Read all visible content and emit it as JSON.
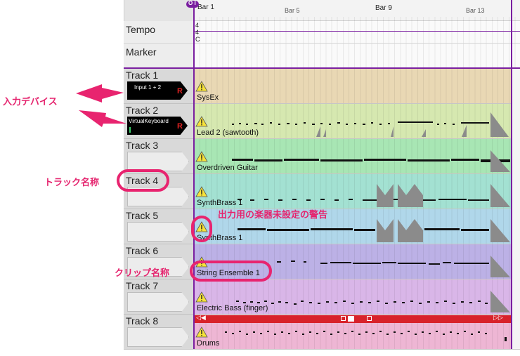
{
  "ruler": {
    "bars": [
      "Bar 1",
      "Bar 5",
      "Bar 9",
      "Bar 13"
    ],
    "playhead_label": "O I"
  },
  "global_tracks": {
    "tempo_label": "Tempo",
    "marker_label": "Marker",
    "time_signature": [
      "4",
      "4"
    ],
    "key": "C"
  },
  "tracks": [
    {
      "name": "Track 1",
      "device": "Input 1 + 2",
      "rec": "R",
      "clip": "SysEx",
      "color": "#e9d8b4"
    },
    {
      "name": "Track 2",
      "device": "VirtualKeyboard",
      "rec": "R",
      "clip": "Lead 2 (sawtooth)",
      "color": "#d6e8b0"
    },
    {
      "name": "Track 3",
      "device": "",
      "rec": "",
      "clip": "Overdriven Guitar",
      "color": "#a8e6b4"
    },
    {
      "name": "Track 4",
      "device": "",
      "rec": "",
      "clip": "SynthBrass 1",
      "color": "#a3e1d2"
    },
    {
      "name": "Track 5",
      "device": "",
      "rec": "",
      "clip": "SynthBrass 1",
      "color": "#b0d7ea"
    },
    {
      "name": "Track 6",
      "device": "",
      "rec": "",
      "clip": "String Ensemble 1",
      "color": "#bcb1e6"
    },
    {
      "name": "Track 7",
      "device": "",
      "rec": "",
      "clip": "Electric Bass (finger)",
      "color": "#d9b6e8"
    },
    {
      "name": "Track 8",
      "device": "",
      "rec": "",
      "clip": "Drums",
      "color": "#eeb6d4"
    }
  ],
  "annotations": {
    "input_device": "入力デバイス",
    "track_name": "トラック名称",
    "warning": "出力用の楽器未設定の警告",
    "clip_name": "クリップ名称"
  },
  "colors": {
    "accent": "#7a1fa0",
    "callout": "#e5246e",
    "loop_bar": "#d8222a"
  }
}
